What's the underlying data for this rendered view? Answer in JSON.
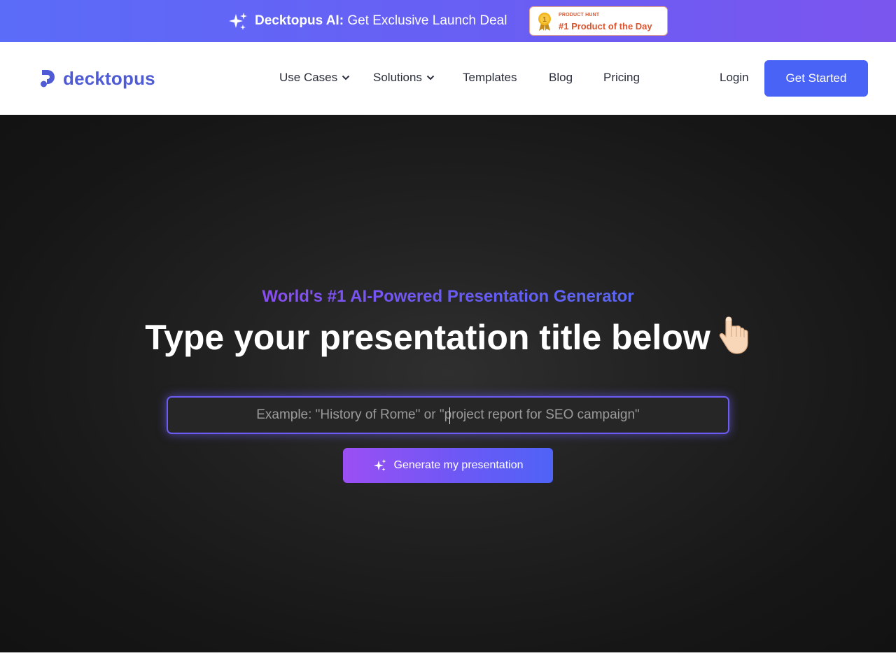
{
  "banner": {
    "brand": "Decktopus AI:",
    "text": "Get Exclusive Launch Deal",
    "icon": "sparkle-icon",
    "badge": {
      "small": "PRODUCT HUNT",
      "big": "#1 Product of the Day",
      "icon": "medal-icon",
      "medal_number": "1",
      "color": "#da552f"
    }
  },
  "header": {
    "logo_text": "decktopus",
    "nav": {
      "use_cases": "Use Cases",
      "solutions": "Solutions",
      "templates": "Templates",
      "blog": "Blog",
      "pricing": "Pricing"
    },
    "login": "Login",
    "cta": "Get Started"
  },
  "hero": {
    "tagline": "World's #1 AI-Powered Presentation Generator",
    "headline": "Type your presentation title below",
    "headline_icon": "pointing-down-hand-icon",
    "input_placeholder": "Example: \"History of Rome\" or \"project report for SEO campaign\"",
    "input_value": "",
    "generate_label": "Generate my presentation"
  },
  "colors": {
    "accent": "#4a63f7",
    "brand": "#4f5bd5",
    "gradient_start": "#8a4df2",
    "gradient_end": "#4f63f7",
    "hero_bg": "#1a1a1a"
  }
}
